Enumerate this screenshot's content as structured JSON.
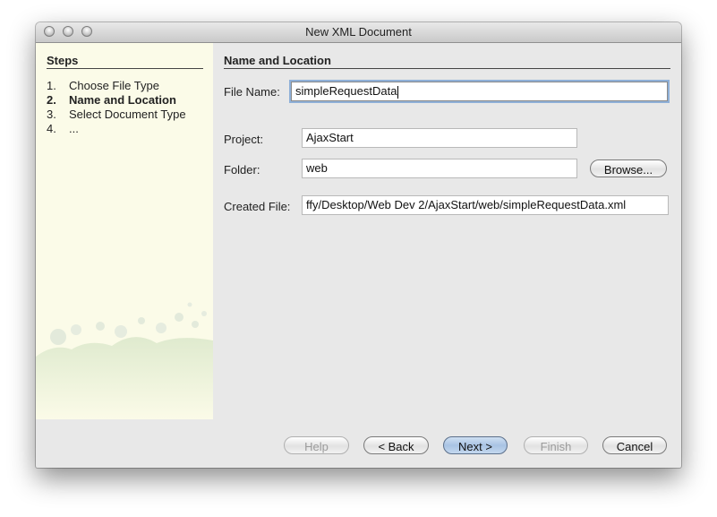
{
  "window": {
    "title": "New XML Document"
  },
  "sidebar": {
    "heading": "Steps",
    "steps": [
      {
        "num": "1.",
        "label": "Choose File Type",
        "active": false
      },
      {
        "num": "2.",
        "label": "Name and Location",
        "active": true
      },
      {
        "num": "3.",
        "label": "Select Document Type",
        "active": false
      },
      {
        "num": "4.",
        "label": "...",
        "active": false
      }
    ]
  },
  "main": {
    "heading": "Name and Location",
    "file_name_label": "File Name:",
    "file_name_value": "simpleRequestData",
    "project_label": "Project:",
    "project_value": "AjaxStart",
    "folder_label": "Folder:",
    "folder_value": "web",
    "browse_label": "Browse...",
    "created_file_label": "Created File:",
    "created_file_value": "ffy/Desktop/Web Dev 2/AjaxStart/web/simpleRequestData.xml"
  },
  "buttons": {
    "help": "Help",
    "back": "< Back",
    "next": "Next >",
    "finish": "Finish",
    "cancel": "Cancel"
  }
}
